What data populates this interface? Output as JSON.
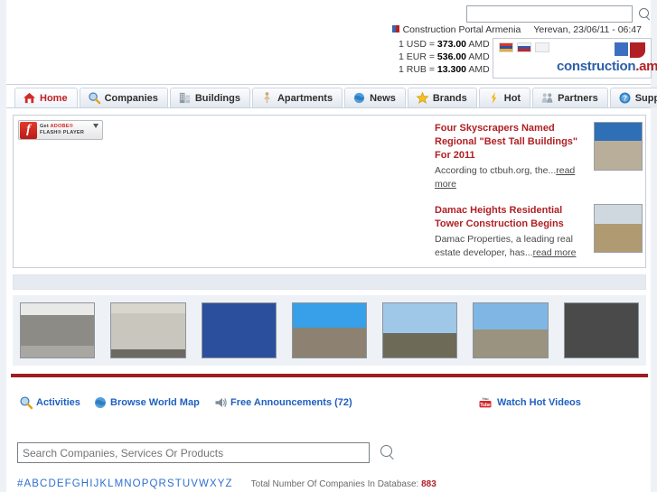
{
  "header": {
    "search_placeholder": "",
    "search_value": "",
    "search_icon": "search-icon",
    "portal_name": "Construction Portal Armenia",
    "location_datetime": "Yerevan, 23/06/11 - 06:47",
    "rates": [
      {
        "label": "1 USD =",
        "value": "373.00",
        "unit": "AMD"
      },
      {
        "label": "1 EUR =",
        "value": "536.00",
        "unit": "AMD"
      },
      {
        "label": "1 RUB =",
        "value": "13.300",
        "unit": "AMD"
      }
    ],
    "logo": {
      "text_main": "construction",
      "text_accent": ".am",
      "languages": [
        "flag-armenia-icon",
        "flag-russia-icon",
        "flag-english-icon"
      ]
    }
  },
  "nav": {
    "tabs": [
      {
        "label": "Home",
        "icon": "home-icon",
        "active": true
      },
      {
        "label": "Companies",
        "icon": "magnifier-icon",
        "active": false
      },
      {
        "label": "Buildings",
        "icon": "building-icon",
        "active": false
      },
      {
        "label": "Apartments",
        "icon": "person-icon",
        "active": false
      },
      {
        "label": "News",
        "icon": "globe-icon",
        "active": false
      },
      {
        "label": "Brands",
        "icon": "star-icon",
        "active": false
      },
      {
        "label": "Hot",
        "icon": "flame-icon",
        "active": false
      },
      {
        "label": "Partners",
        "icon": "handshake-icon",
        "active": false
      },
      {
        "label": "Support",
        "icon": "question-icon",
        "active": false
      }
    ]
  },
  "main": {
    "flash_badge": {
      "line1_get": "Get",
      "line1_adobe": "ADOBE®",
      "line2": "FLASH® PLAYER",
      "icon": "flash-player-icon",
      "download_icon": "download-arrow-icon"
    },
    "news": [
      {
        "title": "Four Skyscrapers Named Regional \"Best Tall Buildings\" For 2011",
        "summary": "According to ctbuh.org, the...",
        "read_more": "read more",
        "thumb": "skyscraper-photo"
      },
      {
        "title": "Damac Heights Residential Tower Construction Begins",
        "summary": "Damac Properties, a leading real estate developer, has...",
        "read_more": "read more",
        "thumb": "construction-site-photo"
      }
    ]
  },
  "gallery": {
    "thumbs": [
      "circular-building-photo",
      "concrete-building-under-construction-photo",
      "blue-scaffolding-photo",
      "stone-church-blue-sky-photo",
      "monastery-photo",
      "church-conical-dome-photo",
      "highrise-towers-photo"
    ]
  },
  "footer": {
    "links": [
      {
        "label": "Activities",
        "icon": "magnifier-icon"
      },
      {
        "label": "Browse World Map",
        "icon": "globe-icon"
      },
      {
        "label": "Free Announcements (72)",
        "icon": "megaphone-icon"
      },
      {
        "label": "Watch Hot Videos",
        "icon": "youtube-icon"
      }
    ],
    "search_placeholder": "Search Companies, Services Or Products",
    "search_value": "",
    "search_icon": "search-icon",
    "alphabet": "#ABCDEFGHIJKLMNOPQRSTUVWXYZ",
    "db_label": "Total Number Of Companies In Database:",
    "db_count": "883"
  },
  "colors": {
    "accent_red": "#b02025",
    "link_blue": "#1f5fc0",
    "panel_border": "#c7ced8"
  }
}
